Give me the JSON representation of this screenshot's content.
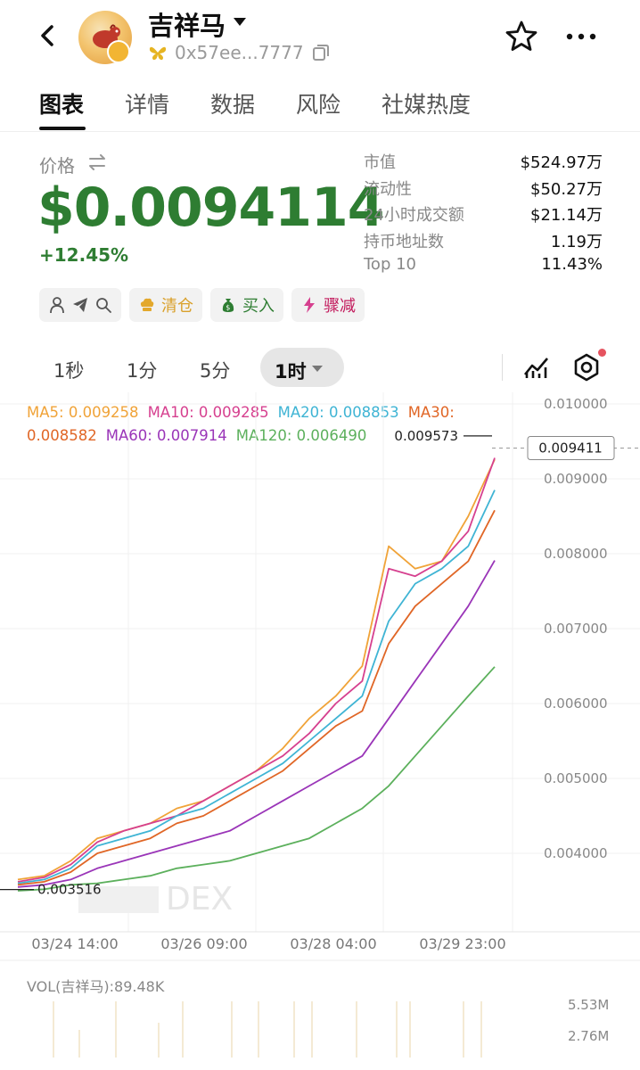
{
  "token": {
    "name": "吉祥马",
    "address": "0x57ee...7777"
  },
  "tabs": [
    "图表",
    "详情",
    "数据",
    "风险",
    "社媒热度"
  ],
  "price": {
    "label": "价格",
    "value": "$0.0094114",
    "change": "+12.45%"
  },
  "stats": [
    {
      "k": "市值",
      "v": "$524.97万"
    },
    {
      "k": "流动性",
      "v": "$50.27万"
    },
    {
      "k": "24小时成交额",
      "v": "$21.14万"
    },
    {
      "k": "持币地址数",
      "v": "1.19万"
    },
    {
      "k": "Top 10",
      "v": "11.43%"
    }
  ],
  "actions": [
    "清仓",
    "买入",
    "骤减"
  ],
  "intervals": [
    "1秒",
    "1分",
    "5分",
    "1时"
  ],
  "ma_legend": [
    {
      "text": "MA5: 0.009258",
      "color": "#f0a338"
    },
    {
      "text": "MA10: 0.009285",
      "color": "#d6408f"
    },
    {
      "text": "MA20: 0.008853",
      "color": "#3fb4d4"
    },
    {
      "text": "MA30:",
      "color": "#e06626"
    },
    {
      "text": "0.008582",
      "color": "#e06626"
    },
    {
      "text": "MA60: 0.007914",
      "color": "#9a35b8"
    },
    {
      "text": "MA120: 0.006490",
      "color": "#5cb05c"
    }
  ],
  "chart_data": {
    "type": "line",
    "y_ticks": [
      "0.010000",
      "0.009000",
      "0.008000",
      "0.007000",
      "0.006000",
      "0.005000",
      "0.004000"
    ],
    "y_tick_values": [
      0.01,
      0.009,
      0.008,
      0.007,
      0.006,
      0.005,
      0.004
    ],
    "x_ticks": [
      "03/24 14:00",
      "03/26 09:00",
      "03/28 04:00",
      "03/29 23:00"
    ],
    "high_label": "0.009573",
    "high_value": 0.009573,
    "low_label": "0.003516",
    "low_value": 0.003516,
    "current_label": "0.009411",
    "current_value": 0.009411,
    "ylim": [
      0.0033,
      0.0103
    ],
    "watermark": "DEX",
    "series": [
      {
        "name": "MA5",
        "color": "#f0a338",
        "values": [
          0.00365,
          0.0037,
          0.0039,
          0.0042,
          0.0043,
          0.0044,
          0.0046,
          0.0047,
          0.0049,
          0.0051,
          0.0054,
          0.0058,
          0.0061,
          0.0065,
          0.0081,
          0.0078,
          0.0079,
          0.0085,
          0.00926
        ]
      },
      {
        "name": "MA10",
        "color": "#d6408f",
        "values": [
          0.00362,
          0.00368,
          0.00385,
          0.00415,
          0.0043,
          0.0044,
          0.0045,
          0.0047,
          0.0049,
          0.0051,
          0.0053,
          0.0056,
          0.006,
          0.0063,
          0.0078,
          0.0077,
          0.0079,
          0.0083,
          0.00928
        ]
      },
      {
        "name": "MA20",
        "color": "#3fb4d4",
        "values": [
          0.0036,
          0.00365,
          0.0038,
          0.0041,
          0.0042,
          0.0043,
          0.0045,
          0.0046,
          0.0048,
          0.005,
          0.0052,
          0.0055,
          0.0058,
          0.0061,
          0.0071,
          0.0076,
          0.0078,
          0.0081,
          0.00885
        ]
      },
      {
        "name": "MA30",
        "color": "#e06626",
        "values": [
          0.00358,
          0.00362,
          0.00375,
          0.004,
          0.0041,
          0.0042,
          0.0044,
          0.0045,
          0.0047,
          0.0049,
          0.0051,
          0.0054,
          0.0057,
          0.0059,
          0.0068,
          0.0073,
          0.0076,
          0.0079,
          0.00858
        ]
      },
      {
        "name": "MA60",
        "color": "#9a35b8",
        "values": [
          0.00355,
          0.00358,
          0.00365,
          0.0038,
          0.0039,
          0.004,
          0.0041,
          0.0042,
          0.0043,
          0.0045,
          0.0047,
          0.0049,
          0.0051,
          0.0053,
          0.0058,
          0.0063,
          0.0068,
          0.0073,
          0.00791
        ]
      },
      {
        "name": "MA120",
        "color": "#5cb05c",
        "values": [
          0.0035,
          0.00352,
          0.00358,
          0.0036,
          0.00365,
          0.0037,
          0.0038,
          0.00385,
          0.0039,
          0.004,
          0.0041,
          0.0042,
          0.0044,
          0.0046,
          0.0049,
          0.0053,
          0.0057,
          0.0061,
          0.00649
        ]
      }
    ]
  },
  "volume": {
    "label": "VOL(吉祥马):89.48K",
    "ticks": [
      "5.53M",
      "2.76M"
    ]
  }
}
